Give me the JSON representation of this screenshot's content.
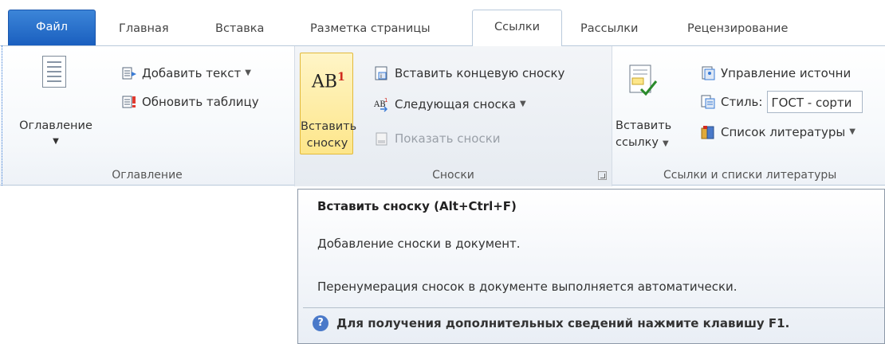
{
  "tabs": {
    "file": "Файл",
    "items": [
      "Главная",
      "Вставка",
      "Разметка страницы",
      "Ссылки",
      "Рассылки",
      "Рецензирование"
    ]
  },
  "groups": {
    "toc": {
      "label": "Оглавление",
      "big_button": "Оглавление",
      "add_text": "Добавить текст",
      "update_table": "Обновить таблицу"
    },
    "footnotes": {
      "label": "Сноски",
      "insert_footnote_line1": "Вставить",
      "insert_footnote_line2": "сноску",
      "insert_endnote": "Вставить концевую сноску",
      "next_footnote": "Следующая сноска",
      "show_notes": "Показать сноски",
      "icon_text": "AB",
      "icon_sup": "1"
    },
    "citations": {
      "label": "Ссылки и списки литературы",
      "insert_citation_line1": "Вставить",
      "insert_citation_line2": "ссылку",
      "manage_sources": "Управление источни",
      "style_label": "Стиль:",
      "style_value": "ГОСТ - сорти",
      "bibliography": "Список литературы"
    }
  },
  "tooltip": {
    "title": "Вставить сноску (Alt+Ctrl+F)",
    "line1": "Добавление сноски в документ.",
    "line2": "Перенумерация сносок в документе выполняется автоматически.",
    "help": "Для получения дополнительных сведений нажмите клавишу F1."
  },
  "colors": {
    "accent": "#1a5fbf",
    "highlight": "#fde68a"
  }
}
